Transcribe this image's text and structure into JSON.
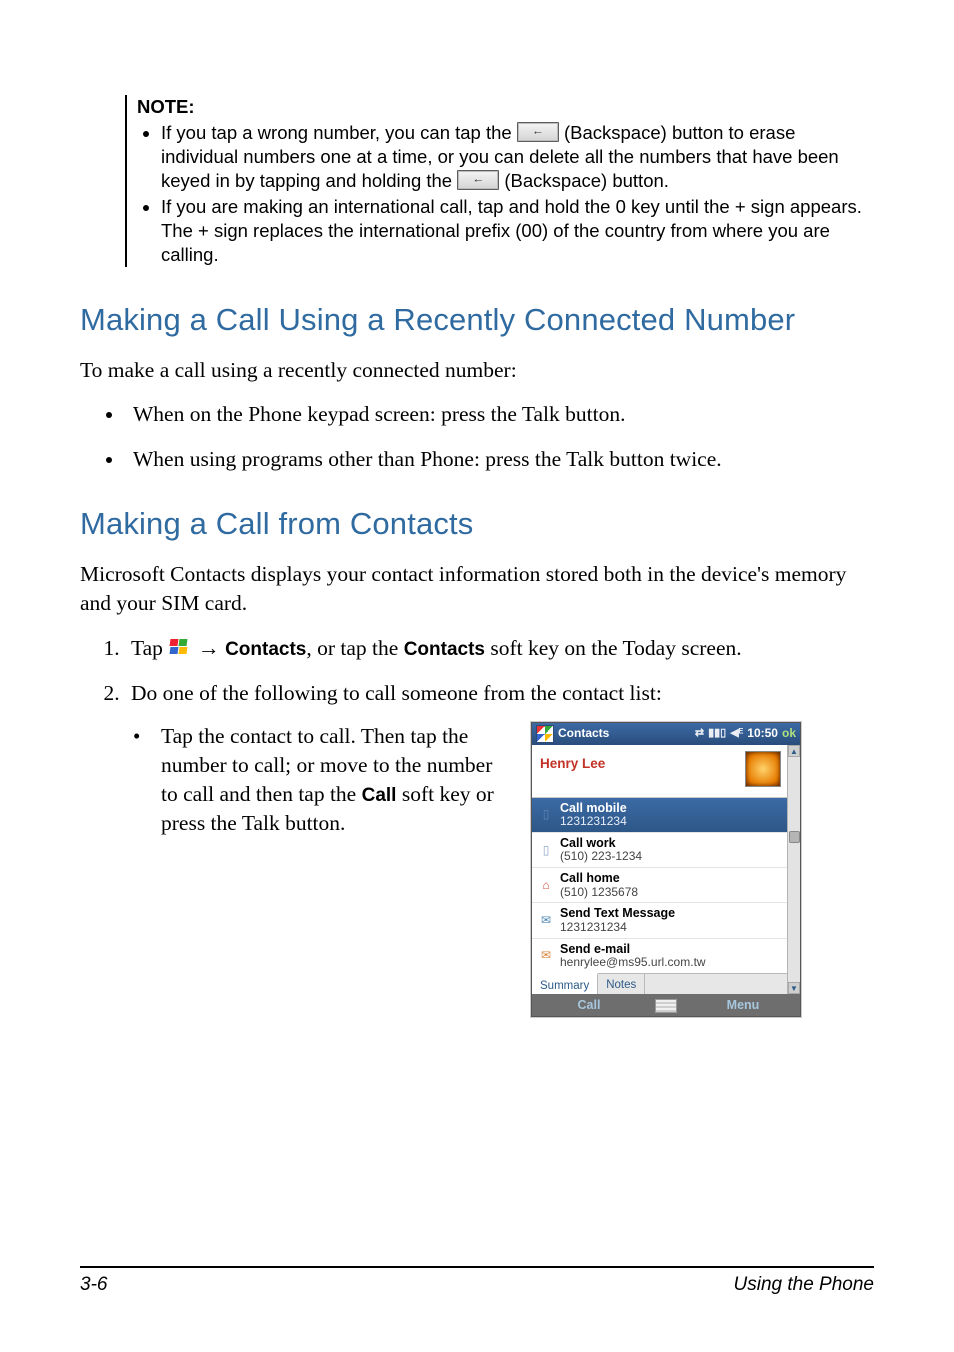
{
  "note": {
    "title": "NOTE:",
    "items": [
      {
        "pre": "If you tap a wrong number, you can tap the ",
        "mid1": " (Backspace) button to erase individual numbers one at a time, or you can delete all the numbers that have been keyed in by tapping and holding the ",
        "post": " (Backspace) button."
      },
      {
        "text": "If you are making an international call, tap and hold the 0 key until the + sign appears. The + sign replaces the international prefix (00) of the country from where you are calling."
      }
    ]
  },
  "section1": {
    "heading": "Making a Call Using a Recently Connected Number",
    "intro": "To make a call using a recently connected number:",
    "bullets": [
      "When on the Phone keypad screen: press the Talk button.",
      "When using programs other than Phone: press the Talk button twice."
    ]
  },
  "section2": {
    "heading": "Making a Call from Contacts",
    "intro": "Microsoft Contacts displays your contact information stored both in the device's memory and your SIM card.",
    "step1": {
      "pre": "Tap ",
      "arrow": "→",
      "contacts_bold": "Contacts",
      "mid": ", or tap the ",
      "contacts_bold2": "Contacts",
      "post": " soft key on the Today screen."
    },
    "step2_intro": "Do one of the following to call someone from the contact list:",
    "step2_bullet": {
      "part1": "Tap the contact to call. Then tap the number to call; or move to the number to call and then tap the ",
      "call_bold": "Call",
      "part2": " soft key or press the Talk button."
    }
  },
  "phone": {
    "title": "Contacts",
    "time": "10:50",
    "ok": "ok",
    "contact_name": "Henry Lee",
    "rows": [
      {
        "icon": "mobile",
        "label": "Call mobile",
        "value": "1231231234",
        "selected": true
      },
      {
        "icon": "work",
        "label": "Call work",
        "value": "(510) 223-1234"
      },
      {
        "icon": "home",
        "label": "Call home",
        "value": "(510) 1235678"
      },
      {
        "icon": "sms",
        "label": "Send Text Message",
        "value": "1231231234"
      },
      {
        "icon": "mail",
        "label": "Send e-mail",
        "value": "henrylee@ms95.url.com.tw"
      }
    ],
    "tabs": {
      "summary": "Summary",
      "notes": "Notes"
    },
    "softkeys": {
      "left": "Call",
      "right": "Menu"
    }
  },
  "footer": {
    "left": "3-6",
    "right": "Using the Phone"
  }
}
